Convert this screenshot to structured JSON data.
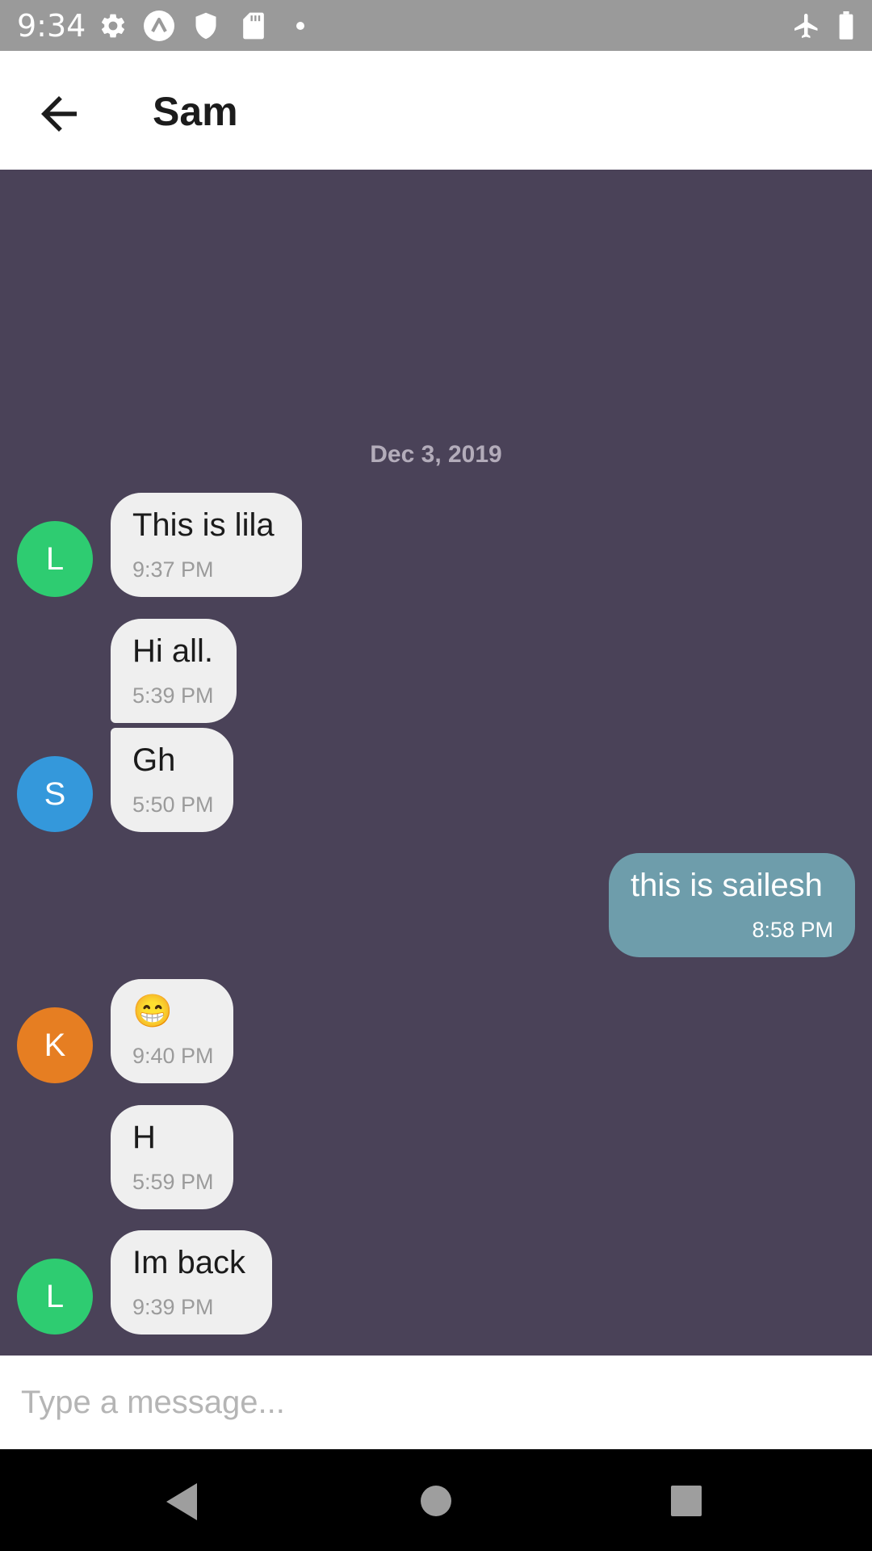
{
  "status_bar": {
    "time": "9:34",
    "icons": [
      "gear-icon",
      "app-logo-icon",
      "shield-icon",
      "sd-card-icon",
      "dot-icon",
      "airplane-mode-icon",
      "battery-icon"
    ]
  },
  "header": {
    "back_icon": "arrow-back-icon",
    "title": "Sam"
  },
  "chat": {
    "date_separator": "Dec 3, 2019",
    "messages": [
      {
        "text": "This is lila",
        "time": "9:37 PM",
        "direction": "in",
        "avatar": "L",
        "avatar_color": "#2ecc71"
      },
      {
        "text": "Hi all.",
        "time": "5:39 PM",
        "direction": "in",
        "avatar": "",
        "avatar_color": ""
      },
      {
        "text": "Gh",
        "time": "5:50 PM",
        "direction": "in",
        "avatar": "S",
        "avatar_color": "#3498db"
      },
      {
        "text": "this is sailesh",
        "time": "8:58 PM",
        "direction": "out",
        "avatar": "",
        "avatar_color": ""
      },
      {
        "text": "😁",
        "time": "9:40 PM",
        "direction": "in",
        "avatar": "K",
        "avatar_color": "#e67e22"
      },
      {
        "text": "H",
        "time": "5:59 PM",
        "direction": "in",
        "avatar": "",
        "avatar_color": ""
      },
      {
        "text": "Im back",
        "time": "9:39 PM",
        "direction": "in",
        "avatar": "L",
        "avatar_color": "#2ecc71"
      }
    ]
  },
  "composer": {
    "placeholder": "Type a message...",
    "value": ""
  },
  "nav_bar": {
    "icons": [
      "back-triangle-icon",
      "home-circle-icon",
      "recents-square-icon"
    ]
  },
  "colors": {
    "status_bar": "#9a9a9a",
    "chat_background": "#4a4258",
    "incoming_bubble": "#efefef",
    "outgoing_bubble": "#6e9dab"
  }
}
